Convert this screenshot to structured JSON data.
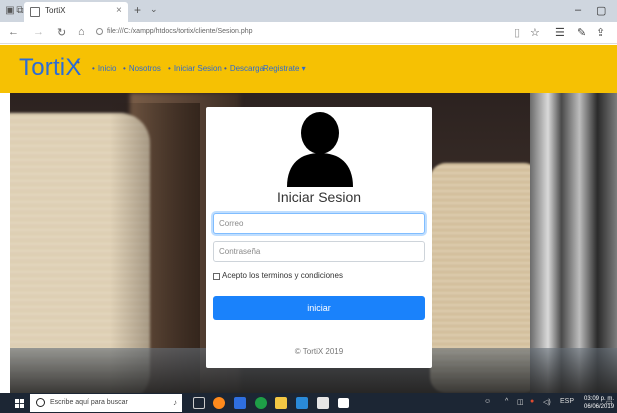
{
  "browser": {
    "tab_title": "TortiX",
    "tab_close": "×",
    "new_tab": "+",
    "tab_menu": "⌄",
    "url": "file:///C:/xampp/htdocs/tortix/cliente/Sesion.php",
    "window_min": "–",
    "window_max": "▢"
  },
  "site_nav": {
    "brand": "TortiX",
    "links": [
      {
        "label": "Inicio"
      },
      {
        "label": "Nosotros"
      },
      {
        "label": "Iniciar Sesion"
      },
      {
        "label": "Descarga"
      },
      {
        "label": "Registrate ▾"
      }
    ]
  },
  "login": {
    "title": "Iniciar Sesion",
    "email_placeholder": "Correo",
    "email_value": "",
    "password_placeholder": "Contraseña",
    "password_value": "",
    "terms_label": "Acepto los terminos y condiciones",
    "terms_checked": false,
    "submit_label": "iniciar",
    "footer": "© TortiX 2019"
  },
  "taskbar": {
    "search_placeholder": "Escribe aquí para buscar",
    "tray_lang": "ESP",
    "time": "03:09 p. m.",
    "date": "06/06/2019"
  },
  "colors": {
    "navbar_bg": "#f6c103",
    "brand": "#2b6cd7",
    "button": "#1a82fb",
    "taskbar": "#1c2634"
  }
}
